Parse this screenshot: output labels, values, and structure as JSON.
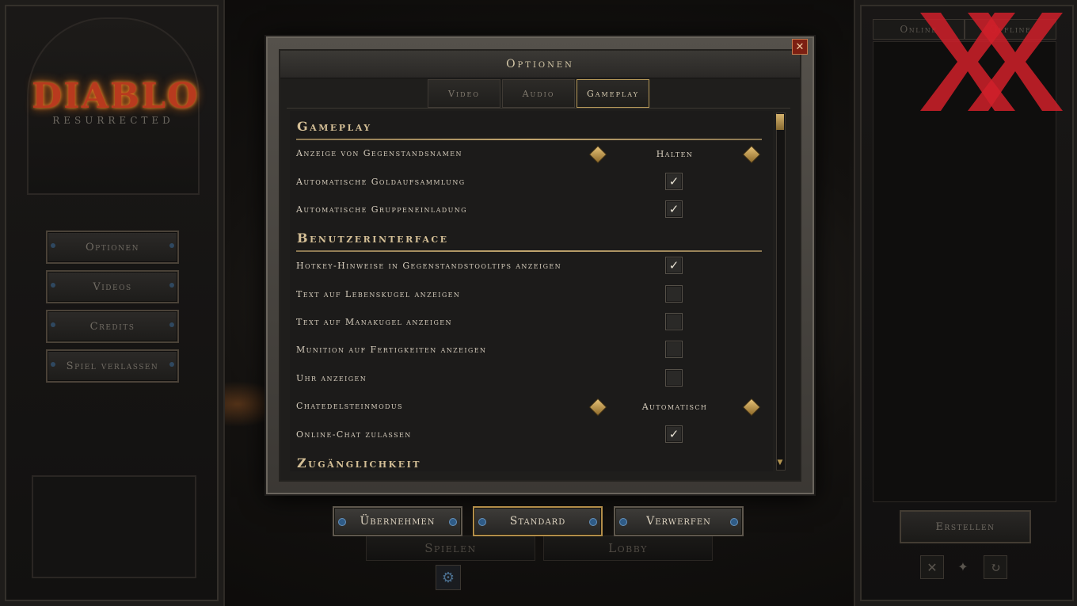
{
  "left_menu": {
    "logo_title": "DIABLO",
    "logo_subtitle": "RESURRECTED",
    "buttons": [
      "Optionen",
      "Videos",
      "Credits",
      "Spiel verlassen"
    ]
  },
  "background_buttons": {
    "play": "Spielen",
    "lobby": "Lobby"
  },
  "right_panel": {
    "tabs": [
      "Online",
      "Offline"
    ],
    "create_button": "Erstellen"
  },
  "dialog": {
    "title": "Optionen",
    "close_glyph": "✕",
    "tabs": [
      {
        "label": "Video",
        "active": false
      },
      {
        "label": "Audio",
        "active": false
      },
      {
        "label": "Gameplay",
        "active": true
      }
    ],
    "sections": {
      "gameplay": "Gameplay",
      "ui": "Benutzerinterface",
      "accessibility": "Zugänglichkeit"
    },
    "settings": {
      "item_names": {
        "label": "Anzeige von Gegenstandsnamen",
        "value": "Halten"
      },
      "auto_gold": {
        "label": "Automatische Goldaufsammlung",
        "checked": true
      },
      "auto_party": {
        "label": "Automatische Gruppeneinladung",
        "checked": true
      },
      "hotkey_hints": {
        "label": "Hotkey-Hinweise in Gegenstandstooltips anzeigen",
        "checked": true
      },
      "life_orb_text": {
        "label": "Text auf Lebenskugel anzeigen",
        "checked": false
      },
      "mana_orb_text": {
        "label": "Text auf Manakugel anzeigen",
        "checked": false
      },
      "skill_ammo": {
        "label": "Munition auf Fertigkeiten anzeigen",
        "checked": false
      },
      "clock": {
        "label": "Uhr anzeigen",
        "checked": false
      },
      "chat_gem": {
        "label": "Chatedelsteinmodus",
        "value": "Automatisch"
      },
      "online_chat": {
        "label": "Online-Chat zulassen",
        "checked": true
      }
    },
    "actions": {
      "apply": "Übernehmen",
      "default": "Standard",
      "discard": "Verwerfen"
    }
  },
  "colors": {
    "accent_gold": "#c1a56e",
    "close_red": "#7c1f12",
    "watermark_red": "#d0202a"
  }
}
